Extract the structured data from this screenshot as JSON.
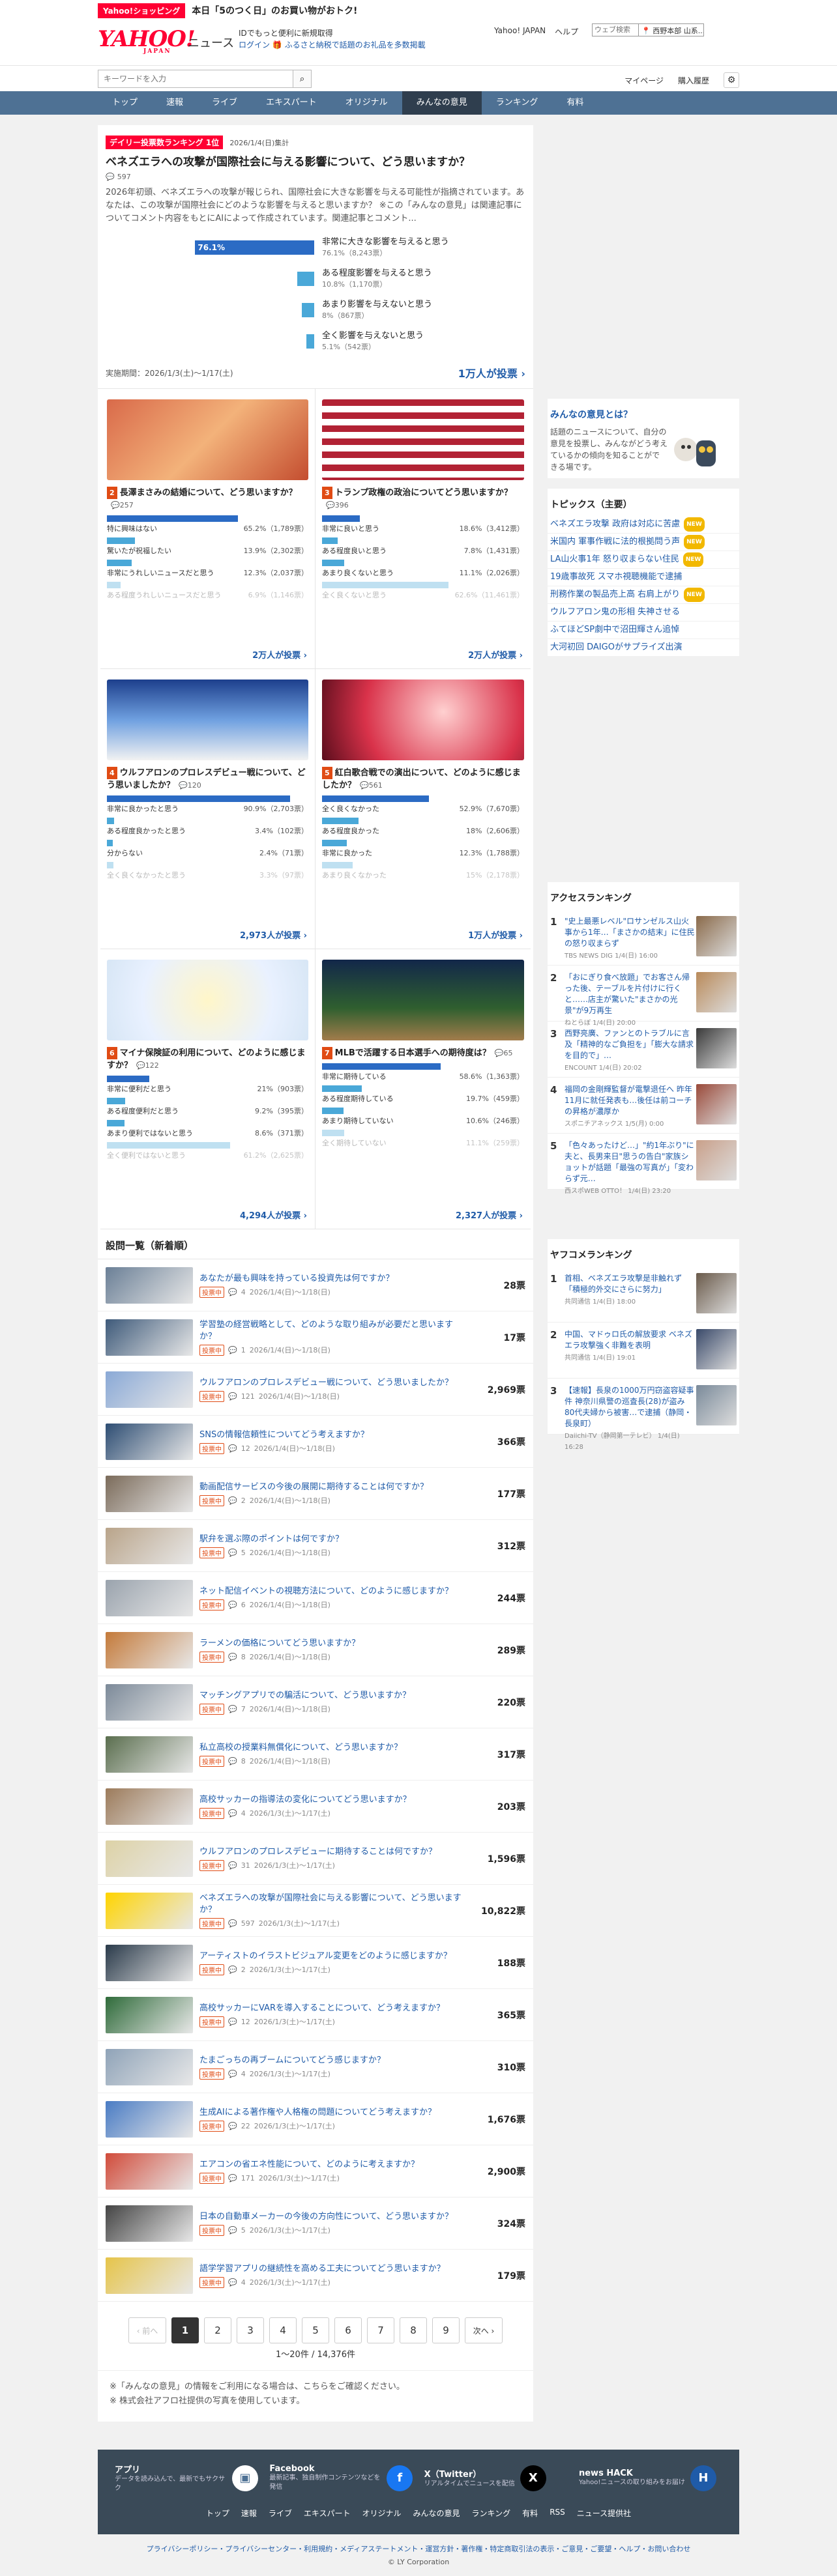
{
  "strip": {
    "tag": "Yahoo!ショッピング",
    "text": "本日「5のつく日」のお買い物がおトク!"
  },
  "header": {
    "logo": "YAHOO!",
    "logo_sub": "JAPAN",
    "site": "ニュース",
    "login_line1": "IDでもっと便利に新規取得",
    "login_line2": "ログイン 🎁 ふるさと納税で話題のお礼品を多数掲載",
    "links": [
      "Yahoo! JAPAN",
      "ヘルプ"
    ],
    "search_placeholder": "ウェブ検索",
    "region": "📍 西野本部 山系..."
  },
  "searchbar": {
    "placeholder": "キーワードを入力",
    "mypage": "マイページ",
    "history": "購入履歴"
  },
  "nav": [
    "トップ",
    "速報",
    "ライブ",
    "エキスパート",
    "オリジナル",
    "みんなの意見",
    "ランキング",
    "有料"
  ],
  "featured": {
    "rank": "デイリー投票数ランキング 1位",
    "date": "2026/1/4(日)集計",
    "question": "ベネズエラへの攻撃が国際社会に与える影響について、どう思いますか？",
    "comments": "597",
    "desc": "2026年初頭、ベネズエラへの攻撃が報じられ、国際社会に大きな影響を与える可能性が指摘されています。あなたは、この攻撃が国際社会にどのような影響を与えると思いますか？ ※この「みんなの意見」は関連記事についてコメント内容をもとにAIによって作成されています。関連記事とコメント...",
    "options": [
      {
        "label": "非常に大きな影響を与えると思う",
        "detail": "76.1%（8,243票）",
        "pct": 76.1,
        "pct_text": "76.1%"
      },
      {
        "label": "ある程度影響を与えると思う",
        "detail": "10.8%（1,170票）",
        "pct": 10.8,
        "pct_text": ""
      },
      {
        "label": "あまり影響を与えないと思う",
        "detail": "8%（867票）",
        "pct": 8,
        "pct_text": ""
      },
      {
        "label": "全く影響を与えないと思う",
        "detail": "5.1%（542票）",
        "pct": 5.1,
        "pct_text": ""
      }
    ],
    "period": "実施期間：2026/1/3(土)〜1/17(土)",
    "total": "1万人が投票 ›"
  },
  "cards": [
    {
      "n": "2",
      "q": "長澤まさみの結婚について、どう思いますか？",
      "cm": "257",
      "opts": [
        [
          "特に興味はない",
          "65.2%（1,789票）",
          65.2
        ],
        [
          "驚いたが祝福したい",
          "13.9%（2,302票）",
          13.9
        ],
        [
          "非常にうれしいニュースだと思う",
          "12.3%（2,037票）",
          12.3
        ],
        [
          "ある程度うれしいニュースだと思う",
          "6.9%（1,146票）",
          6.9
        ]
      ],
      "total": "2万人が投票 ›"
    },
    {
      "n": "3",
      "q": "トランプ政権の政治についてどう思いますか？",
      "cm": "396",
      "opts": [
        [
          "非常に良いと思う",
          "18.6%（3,412票）",
          18.6
        ],
        [
          "ある程度良いと思う",
          "7.8%（1,431票）",
          7.8
        ],
        [
          "あまり良くないと思う",
          "11.1%（2,026票）",
          11.1
        ],
        [
          "全く良くないと思う",
          "62.6%（11,461票）",
          62.6
        ]
      ],
      "total": "2万人が投票 ›"
    },
    {
      "n": "4",
      "q": "ウルフアロンのプロレスデビュー戦について、どう思いましたか？",
      "cm": "120",
      "opts": [
        [
          "非常に良かったと思う",
          "90.9%（2,703票）",
          90.9
        ],
        [
          "ある程度良かったと思う",
          "3.4%（102票）",
          3.4
        ],
        [
          "分からない",
          "2.4%（71票）",
          2.4
        ],
        [
          "全く良くなかったと思う",
          "3.3%（97票）",
          3.3
        ]
      ],
      "total": "2,973人が投票 ›"
    },
    {
      "n": "5",
      "q": "紅白歌合戦での演出について、どのように感じましたか？",
      "cm": "561",
      "opts": [
        [
          "全く良くなかった",
          "52.9%（7,670票）",
          52.9
        ],
        [
          "ある程度良かった",
          "18%（2,606票）",
          18
        ],
        [
          "非常に良かった",
          "12.3%（1,788票）",
          12.3
        ],
        [
          "あまり良くなかった",
          "15%（2,178票）",
          15
        ]
      ],
      "total": "1万人が投票 ›"
    },
    {
      "n": "6",
      "q": "マイナ保険証の利用について、どのように感じますか？",
      "cm": "122",
      "opts": [
        [
          "非常に便利だと思う",
          "21%（903票）",
          21
        ],
        [
          "ある程度便利だと思う",
          "9.2%（395票）",
          9.2
        ],
        [
          "あまり便利ではないと思う",
          "8.6%（371票）",
          8.6
        ],
        [
          "全く便利ではないと思う",
          "61.2%（2,625票）",
          61.2
        ]
      ],
      "total": "4,294人が投票 ›"
    },
    {
      "n": "7",
      "q": "MLBで活躍する日本選手への期待度は？",
      "cm": "65",
      "opts": [
        [
          "非常に期待している",
          "58.6%（1,363票）",
          58.6
        ],
        [
          "ある程度期待している",
          "19.7%（459票）",
          19.7
        ],
        [
          "あまり期待していない",
          "10.6%（246票）",
          10.6
        ],
        [
          "全く期待していない",
          "11.1%（259票）",
          11.1
        ]
      ],
      "total": "2,327人が投票 ›"
    }
  ],
  "list_title": "設問一覧（新着順）",
  "list": [
    {
      "t": "あなたが最も興味を持っている投資先は何ですか？",
      "c": "4",
      "d": "2026/1/4(日)〜1/18(日)",
      "v": "28票"
    },
    {
      "t": "学習塾の経営戦略として、どのような取り組みが必要だと思いますか？",
      "c": "1",
      "d": "2026/1/4(日)〜1/18(日)",
      "v": "17票"
    },
    {
      "t": "ウルフアロンのプロレスデビュー戦について、どう思いましたか？",
      "c": "121",
      "d": "2026/1/4(日)〜1/18(日)",
      "v": "2,969票"
    },
    {
      "t": "SNSの情報信頼性についてどう考えますか？",
      "c": "12",
      "d": "2026/1/4(日)〜1/18(日)",
      "v": "366票"
    },
    {
      "t": "動画配信サービスの今後の展開に期待することは何ですか？",
      "c": "2",
      "d": "2026/1/4(日)〜1/18(日)",
      "v": "177票"
    },
    {
      "t": "駅弁を選ぶ際のポイントは何ですか？",
      "c": "5",
      "d": "2026/1/4(日)〜1/18(日)",
      "v": "312票"
    },
    {
      "t": "ネット配信イベントの視聴方法について、どのように感じますか？",
      "c": "6",
      "d": "2026/1/4(日)〜1/18(日)",
      "v": "244票"
    },
    {
      "t": "ラーメンの価格についてどう思いますか？",
      "c": "8",
      "d": "2026/1/4(日)〜1/18(日)",
      "v": "289票"
    },
    {
      "t": "マッチングアプリでの騙活について、どう思いますか？",
      "c": "7",
      "d": "2026/1/4(日)〜1/18(日)",
      "v": "220票"
    },
    {
      "t": "私立高校の授業料無償化について、どう思いますか？",
      "c": "8",
      "d": "2026/1/4(日)〜1/18(日)",
      "v": "317票"
    },
    {
      "t": "高校サッカーの指導法の変化についてどう思いますか？",
      "c": "4",
      "d": "2026/1/3(土)〜1/17(土)",
      "v": "203票"
    },
    {
      "t": "ウルフアロンのプロレスデビューに期待することは何ですか？",
      "c": "31",
      "d": "2026/1/3(土)〜1/17(土)",
      "v": "1,596票"
    },
    {
      "t": "ベネズエラへの攻撃が国際社会に与える影響について、どう思いますか？",
      "c": "597",
      "d": "2026/1/3(土)〜1/17(土)",
      "v": "10,822票"
    },
    {
      "t": "アーティストのイラストビジュアル変更をどのように感じますか？",
      "c": "2",
      "d": "2026/1/3(土)〜1/17(土)",
      "v": "188票"
    },
    {
      "t": "高校サッカーにVARを導入することについて、どう考えますか？",
      "c": "12",
      "d": "2026/1/3(土)〜1/17(土)",
      "v": "365票"
    },
    {
      "t": "たまごっちの再ブームについてどう感じますか？",
      "c": "4",
      "d": "2026/1/3(土)〜1/17(土)",
      "v": "310票"
    },
    {
      "t": "生成AIによる著作権や人格権の問題についてどう考えますか？",
      "c": "22",
      "d": "2026/1/3(土)〜1/17(土)",
      "v": "1,676票"
    },
    {
      "t": "エアコンの省エネ性能について、どのように考えますか？",
      "c": "171",
      "d": "2026/1/3(土)〜1/17(土)",
      "v": "2,900票"
    },
    {
      "t": "日本の自動車メーカーの今後の方向性について、どう思いますか？",
      "c": "5",
      "d": "2026/1/3(土)〜1/17(土)",
      "v": "324票"
    },
    {
      "t": "語学学習アプリの継続性を高める工夫についてどう思いますか？",
      "c": "4",
      "d": "2026/1/3(土)〜1/17(土)",
      "v": "179票"
    }
  ],
  "status_label": "投票中",
  "pager": {
    "prev": "‹ 前へ",
    "pages": [
      "1",
      "2",
      "3",
      "4",
      "5",
      "6",
      "7",
      "8",
      "9"
    ],
    "next": "次へ ›",
    "count": "1〜20件 / 14,376件"
  },
  "notes": [
    "※「みんなの意見」の情報をご利用になる場合は、こちらをご確認ください。",
    "※ 株式会社アフロ社提供の写真を使用しています。"
  ],
  "side": {
    "about_title": "みんなの意見とは？",
    "about_text": "話題のニュースについて、自分の意見を投票し、みんながどう考えているかの傾向を知ることができる場です。",
    "topics_title": "トピックス（主要）",
    "topics": [
      [
        "ベネズエラ攻撃 政府は対応に苦慮",
        true
      ],
      [
        "米国内 軍事作戦に法的根拠問う声",
        true
      ],
      [
        "LA山火事1年 怒り収まらない住民",
        true
      ],
      [
        "19歳事故死 スマホ視聴機能で逮捕",
        false
      ],
      [
        "刑務作業の製品売上高 右肩上がり",
        true
      ],
      [
        "ウルフアロン鬼の形相 失神させる",
        false
      ],
      [
        "ふてほどSP劇中で沼田輝さん追悼",
        false
      ],
      [
        "大河初回 DAIGOがサプライズ出演",
        false
      ]
    ],
    "new_label": "NEW",
    "access_title": "アクセスランキング",
    "access": [
      [
        "1",
        "\"史上最悪レベル\"ロサンゼルス山火事から1年…「まさかの結末」に住民の怒り収まらず",
        "TBS NEWS DIG 1/4(日) 16:00"
      ],
      [
        "2",
        "「おにぎり食べ放題」でお客さん帰った後、テーブルを片付けに行くと……店主が驚いた\"まさかの光景\"が9万再生",
        "ねとらぼ 1/4(日) 20:00"
      ],
      [
        "3",
        "西野亮廣、ファンとのトラブルに言及「精神的なご負担を」「膨大な請求を目的で」…",
        "ENCOUNT 1/4(日) 20:02"
      ],
      [
        "4",
        "福岡の金剛輝監督が電撃退任へ 昨年11月に就任発表も…後任は前コーチの昇格が濃厚か",
        "スポニチアネックス 1/5(月) 0:00"
      ],
      [
        "5",
        "「色々あったけど…」\"約1年ぶり\"に夫と、長男来日\"思うの告白\"家族ショットが話題「最強の写真が」「変わらず元…",
        "西スポWEB OTTO！ 1/4(日) 23:20"
      ]
    ],
    "yafoco_title": "ヤフコメランキング",
    "yafoco": [
      [
        "1",
        "首相、ベネズエラ攻撃是非触れず「積極的外交にさらに努力」",
        "共同通信 1/4(日) 18:00"
      ],
      [
        "2",
        "中国、マドゥロ氏の解放要求 ベネズエラ攻撃強く非難を表明",
        "共同通信 1/4(日) 19:01"
      ],
      [
        "3",
        "【速報】長泉の1000万円窃盗容疑事件 神奈川県警の巡査長(28)が盗み 80代夫婦から被害…で逮捕（静岡・長泉町）",
        "Daiichi-TV（静岡第一テレビ） 1/4(日) 16:28"
      ]
    ]
  },
  "footer": {
    "cols": [
      [
        "アプリ",
        "データを読み込んで、最新でもサクサク"
      ],
      [
        "Facebook",
        "最新記事、独自制作コンテンツなどを発信"
      ],
      [
        "X（Twitter）",
        "リアルタイムでニュースを配信"
      ],
      [
        "news HACK",
        "Yahoo!ニュースの取り組みをお届け"
      ]
    ],
    "links": [
      "トップ",
      "速報",
      "ライブ",
      "エキスパート",
      "オリジナル",
      "みんなの意見",
      "ランキング",
      "有料",
      "RSS",
      "ニュース提供社"
    ],
    "legal": "プライバシーポリシー・プライバシーセンター・利用規約・メディアステートメント・運営方針・著作権・特定商取引法の表示・ご意見・ご要望・ヘルプ・お問い合わせ",
    "copy": "© LY Corporation"
  },
  "colors": {
    "brand": "#ff0033",
    "nav": "#4e7194",
    "bar_winner": "#2b6bc4",
    "bar": "#4aa8d8"
  }
}
